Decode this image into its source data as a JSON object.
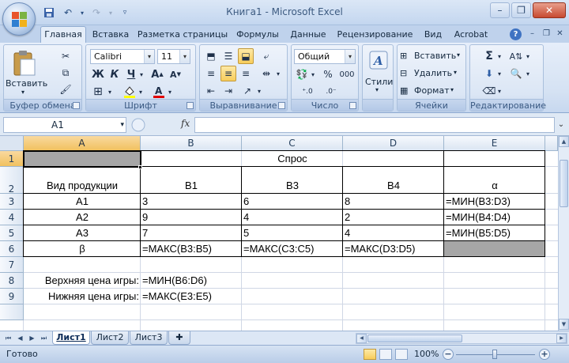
{
  "window": {
    "title": "Книга1 - Microsoft Excel"
  },
  "ribbon_tabs": [
    "Главная",
    "Вставка",
    "Разметка страницы",
    "Формулы",
    "Данные",
    "Рецензирование",
    "Вид",
    "Acrobat"
  ],
  "active_tab": "Главная",
  "groups": {
    "clipboard": {
      "label": "Буфер обмена",
      "paste": "Вставить"
    },
    "font": {
      "label": "Шрифт",
      "font_name": "Calibri",
      "font_size": "11",
      "bold": "Ж",
      "italic": "К",
      "underline": "Ч"
    },
    "alignment": {
      "label": "Выравнивание"
    },
    "number": {
      "label": "Число",
      "format": "Общий",
      "percent": "%",
      "thousands": "000"
    },
    "styles": {
      "label": "Стили",
      "button": "Стили"
    },
    "cells": {
      "label": "Ячейки",
      "insert": "Вставить",
      "delete": "Удалить",
      "format": "Формат"
    },
    "editing": {
      "label": "Редактирование"
    }
  },
  "formula_bar": {
    "name_box": "A1",
    "fx": "fx",
    "formula": ""
  },
  "grid": {
    "columns": [
      "A",
      "B",
      "C",
      "D",
      "E"
    ],
    "rows": [
      "1",
      "2",
      "3",
      "4",
      "5",
      "6",
      "7",
      "8",
      "9"
    ],
    "active_column": "A",
    "active_row": "1",
    "cells": {
      "B1": "Спрос",
      "A2": "Вид продукции",
      "B2": "В1",
      "C2": "В3",
      "D2": "В4",
      "E2": "α",
      "A3": "А1",
      "B3": "3",
      "C3": "6",
      "D3": "8",
      "E3": "=МИН(B3:D3)",
      "A4": "А2",
      "B4": "9",
      "C4": "4",
      "D4": "2",
      "E4": "=МИН(B4:D4)",
      "A5": "А3",
      "B5": "7",
      "C5": "5",
      "D5": "4",
      "E5": "=МИН(B5:D5)",
      "A6": "β",
      "B6": "=МАКС(B3:B5)",
      "C6": "=МАКС(C3:C5)",
      "D6": "=МАКС(D3:D5)",
      "A8": "Верхняя цена игры:",
      "B8": "=МИН(B6:D6)",
      "A9": "Нижняя цена игры:",
      "B9": "=МАКС(E3:E5)"
    }
  },
  "sheets": [
    "Лист1",
    "Лист2",
    "Лист3"
  ],
  "active_sheet": "Лист1",
  "status": {
    "ready": "Готово",
    "zoom": "100%"
  }
}
